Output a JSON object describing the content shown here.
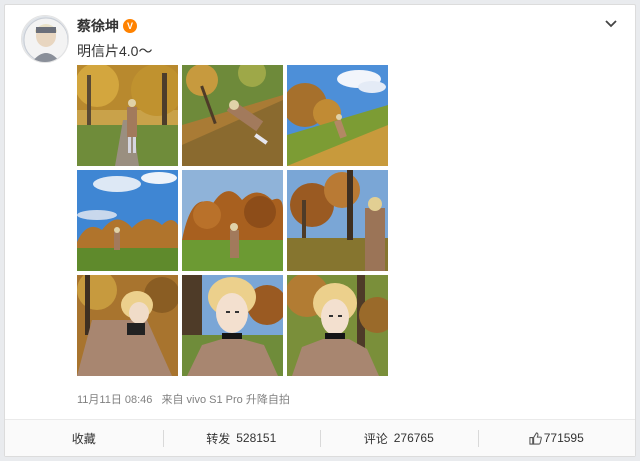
{
  "post": {
    "username": "蔡徐坤",
    "verified_badge": "V",
    "text": "明信片4.0～",
    "timestamp": "11月11日 08:46",
    "source": "来自 vivo S1 Pro 升降自拍"
  },
  "photos": [
    {
      "scene": "autumn-path-standing"
    },
    {
      "scene": "lying-on-leaves"
    },
    {
      "scene": "hill-blue-sky"
    },
    {
      "scene": "blue-sky-field"
    },
    {
      "scene": "field-trees-standing"
    },
    {
      "scene": "close-tree-coat"
    },
    {
      "scene": "selfie-coat-tree"
    },
    {
      "scene": "selfie-closeup-1"
    },
    {
      "scene": "selfie-closeup-2"
    }
  ],
  "actions": {
    "favorite_label": "收藏",
    "repost_label": "转发",
    "repost_count": "528151",
    "comment_label": "评论",
    "comment_count": "276765",
    "like_count": "771595"
  },
  "colors": {
    "badge": "#ff8200",
    "meta": "#808080",
    "background": "#e9ebee"
  },
  "icons": [
    "chevron-down-icon",
    "thumbs-up-icon",
    "verified-badge-icon"
  ]
}
